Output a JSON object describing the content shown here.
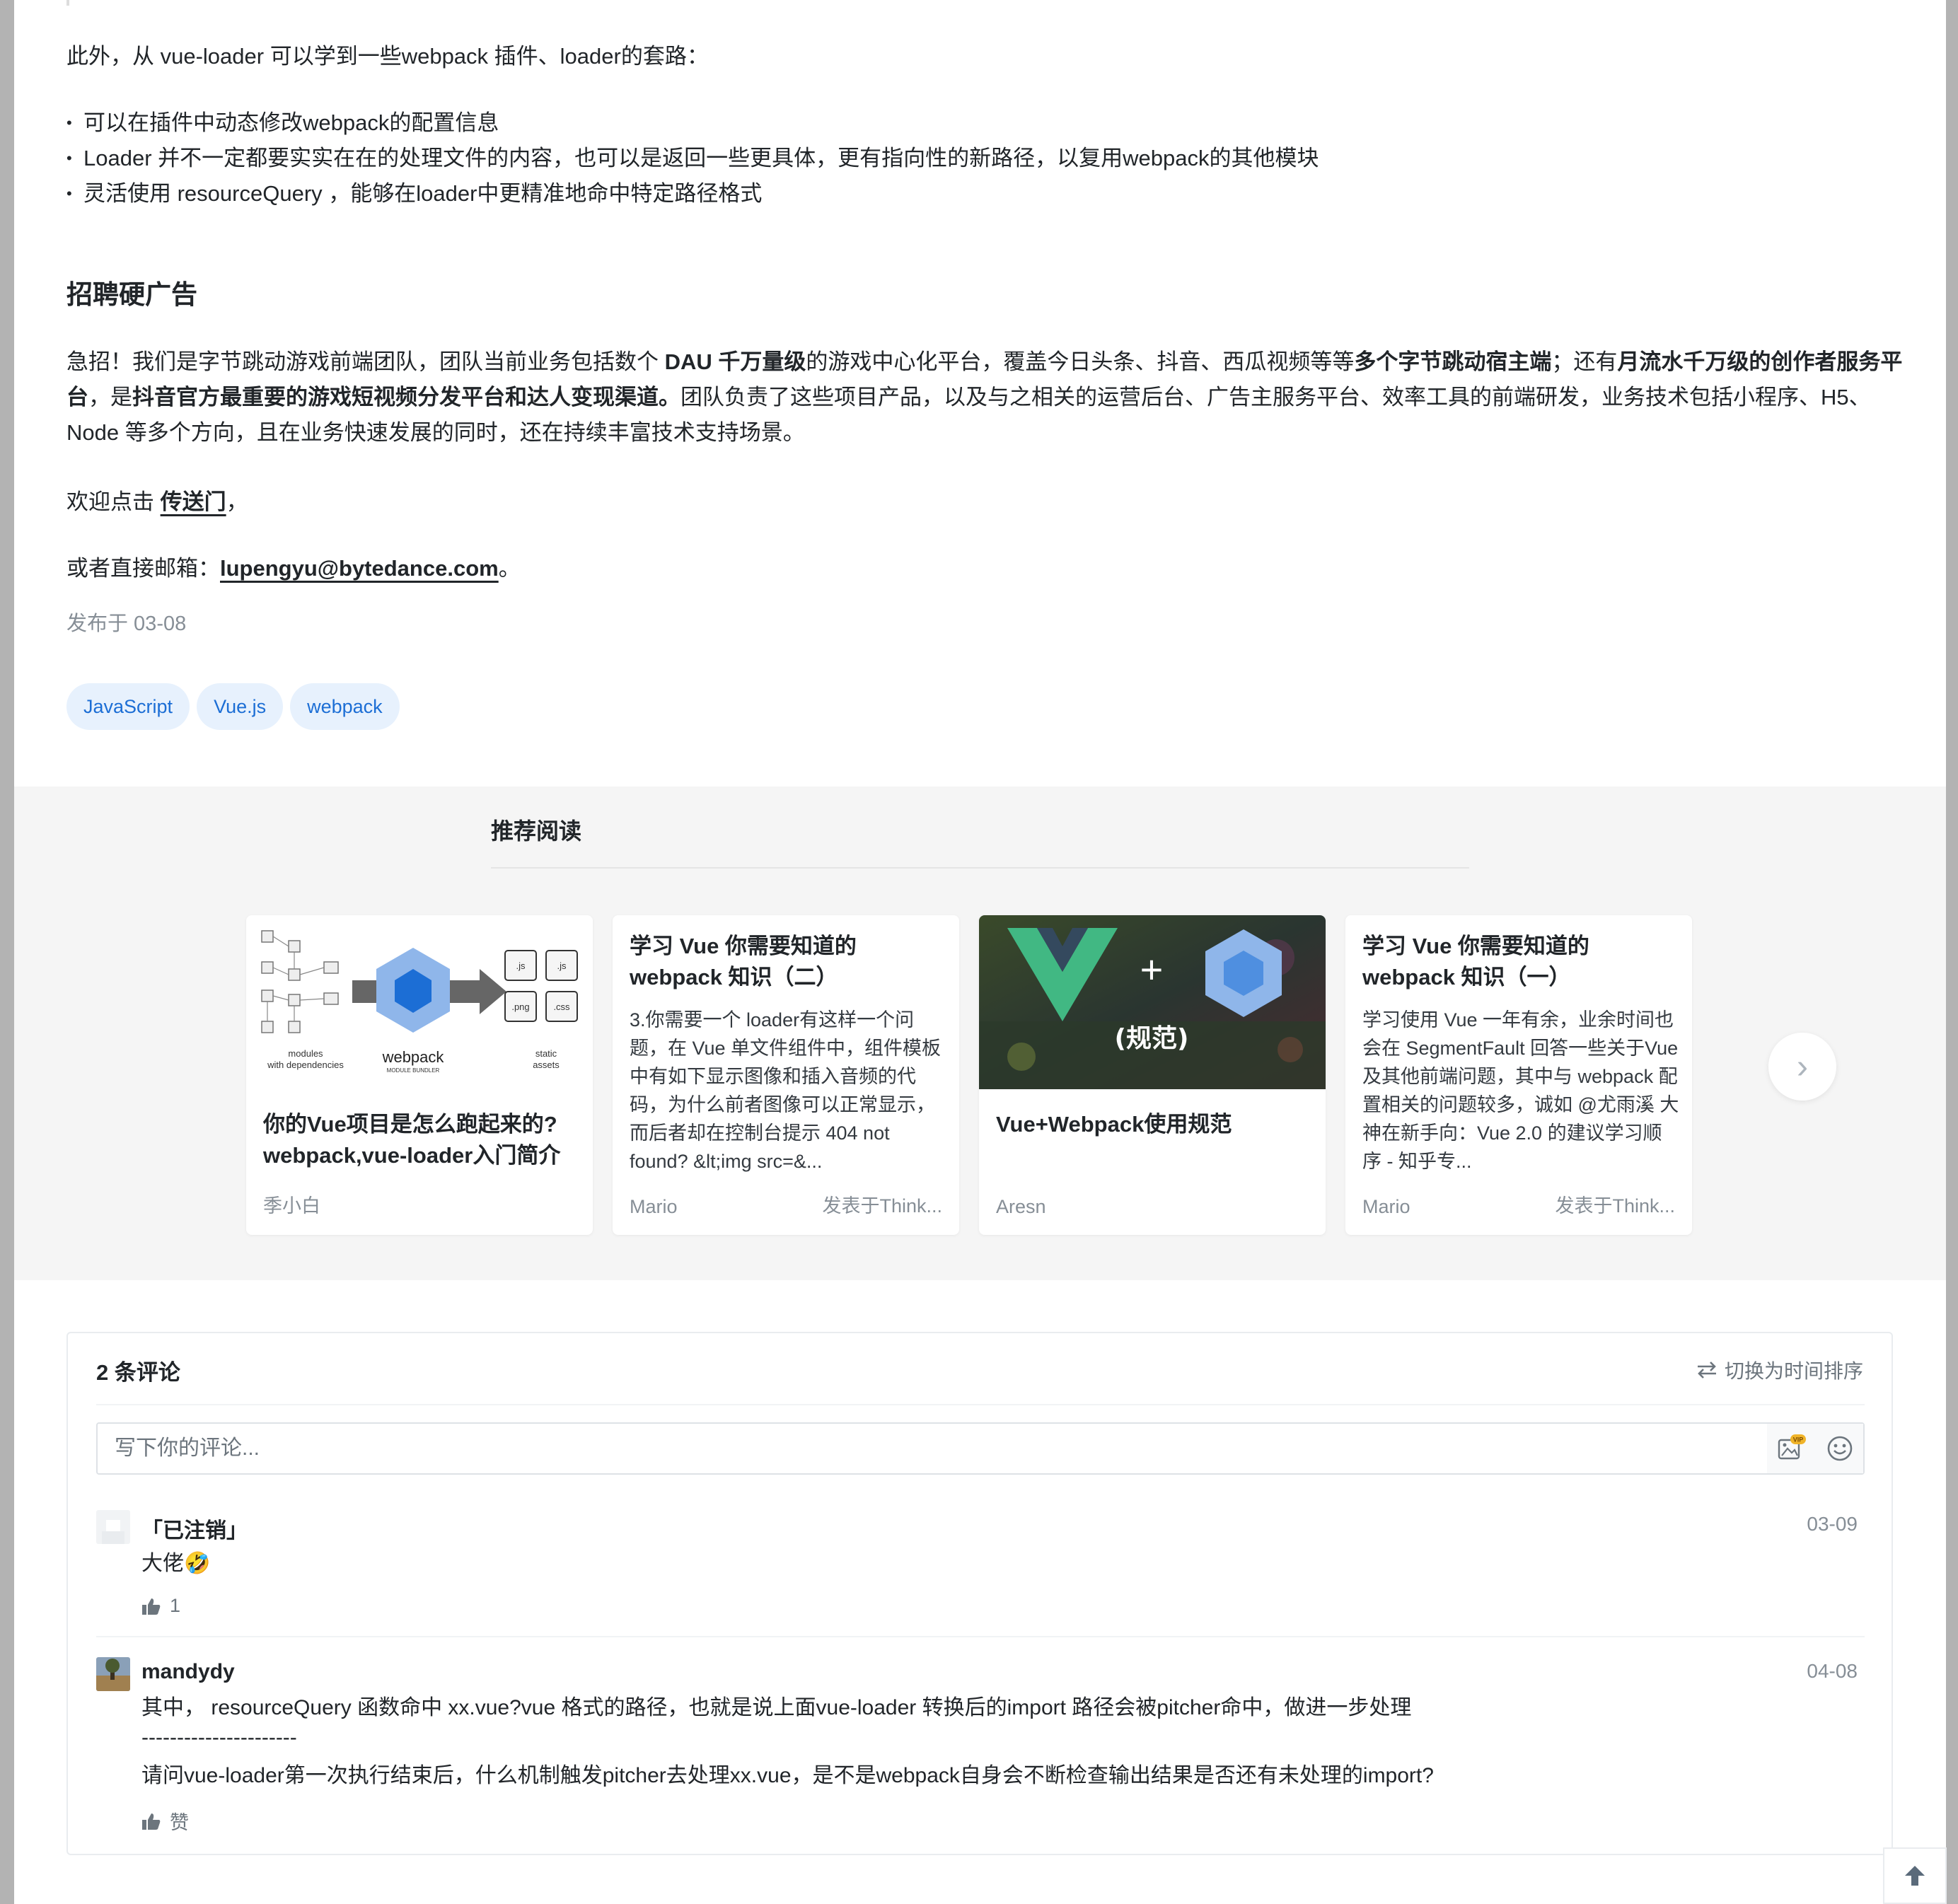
{
  "article": {
    "intro": "此外，从 vue-loader 可以学到一些webpack 插件、loader的套路：",
    "bullets": [
      "可以在插件中动态修改webpack的配置信息",
      "Loader 并不一定都要实实在在的处理文件的内容，也可以是返回一些更具体，更有指向性的新路径，以复用webpack的其他模块",
      "灵活使用 resourceQuery ，能够在loader中更精准地命中特定路径格式"
    ],
    "heading": "招聘硬广告",
    "ad": {
      "p1": "急招！我们是字节跳动游戏前端团队，团队当前业务包括数个 ",
      "b1": "DAU 千万量级",
      "p2": "的游戏中心化平台，覆盖今日头条、抖音、西瓜视频等等",
      "b2": "多个字节跳动宿主端",
      "p3": "；还有",
      "b3": "月流水千万级的创作者服务平台",
      "p4": "，是",
      "b4": "抖音官方最重要的游戏短视频分发平台和达人变现渠道。",
      "p5": "团队负责了这些项目产品，以及与之相关的运营后台、广告主服务平台、效率工具的前端研发，业务技术包括小程序、H5、Node 等多个方向，且在业务快速发展的同时，还在持续丰富技术支持场景。"
    },
    "welcome_prefix": "欢迎点击 ",
    "welcome_link": "传送门",
    "welcome_suffix": "，",
    "email_prefix": "或者直接邮箱：",
    "email": "lupengyu@bytedance.com",
    "email_suffix": "。",
    "published": "发布于 03-08",
    "tags": [
      "JavaScript",
      "Vue.js",
      "webpack"
    ]
  },
  "recommend": {
    "title": "推荐阅读",
    "cards": [
      {
        "title": "你的Vue项目是怎么跑起来的?webpack,vue-loader入门简介",
        "author": "季小白",
        "image_labels": [
          ".js",
          ".js",
          ".png",
          ".css",
          "modules",
          "with dependencies",
          "webpack",
          "MODULE BUNDLER",
          "static",
          "assets"
        ]
      },
      {
        "title": "学习 Vue 你需要知道的 webpack 知识（二）",
        "desc": "3.你需要一个 loader有这样一个问题，在 Vue 单文件组件中，组件模板中有如下显示图像和插入音频的代码，为什么前者图像可以正常显示，而后者却在控制台提示 404 not found?   &lt;img src=&...",
        "author": "Mario",
        "source": "发表于Think..."
      },
      {
        "title": "Vue+Webpack使用规范",
        "author": "Aresn",
        "image_labels": [
          "+",
          "(规范)"
        ]
      },
      {
        "title": "学习 Vue 你需要知道的 webpack 知识（一）",
        "desc": "学习使用 Vue 一年有余，业余时间也会在 SegmentFault 回答一些关于Vue 及其他前端问题，其中与 webpack 配置相关的问题较多，诚如 @尤雨溪 大神在新手向：Vue 2.0 的建议学习顺序 - 知乎专...",
        "author": "Mario",
        "source": "发表于Think..."
      }
    ]
  },
  "comments": {
    "count": "2 条评论",
    "sort_label": "切换为时间排序",
    "placeholder": "写下你的评论...",
    "vip_badge": "VIP",
    "items": [
      {
        "user": "「已注销」",
        "date": "03-09",
        "text": "大佬🤣",
        "likes": "1"
      },
      {
        "user": "mandydy",
        "date": "04-08",
        "line1": "其中， resourceQuery 函数命中 xx.vue?vue 格式的路径，也就是说上面vue-loader 转换后的import 路径会被pitcher命中，做进一步处理",
        "line2": "----------------------",
        "line3": "请问vue-loader第一次执行结束后，什么机制触发pitcher去处理xx.vue，是不是webpack自身会不断检查输出结果是否还有未处理的import?",
        "likes": "赞"
      }
    ]
  },
  "colors": {
    "tag_bg": "#e7f1fd",
    "tag_text": "#1c6ed5",
    "muted": "#868e96",
    "section_bg": "#f5f5f5"
  }
}
